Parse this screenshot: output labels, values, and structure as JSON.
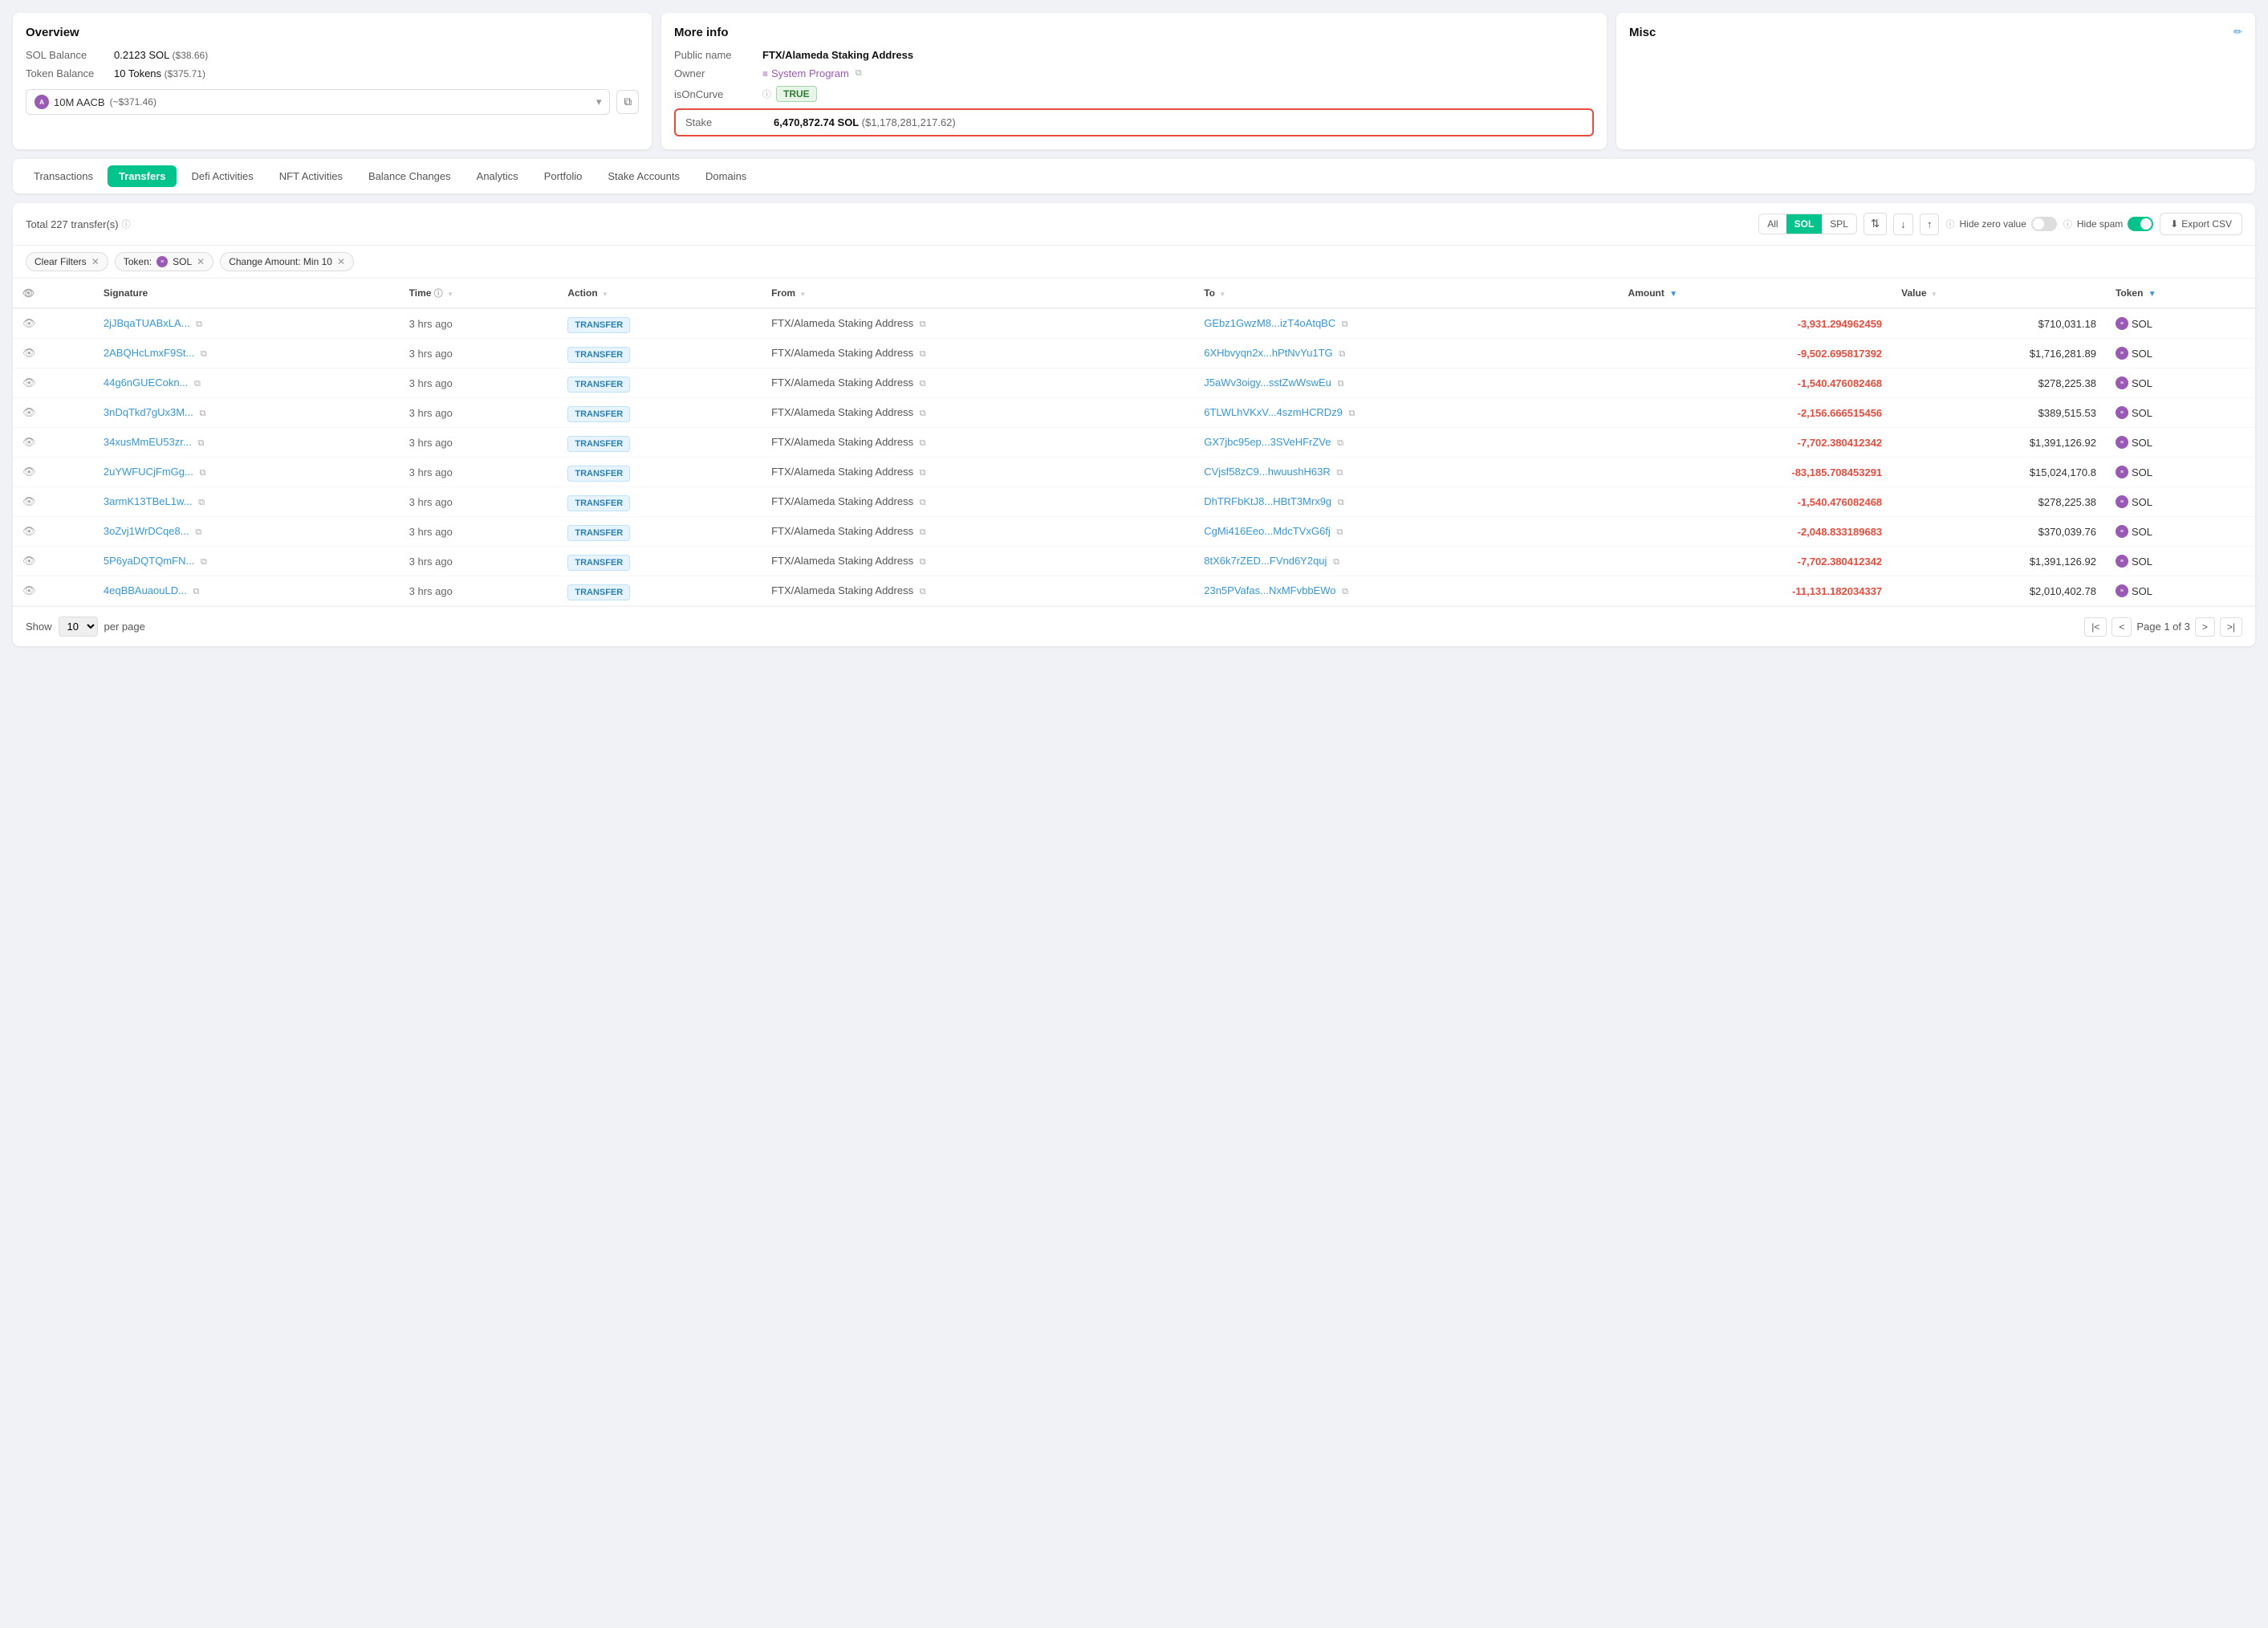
{
  "overview": {
    "title": "Overview",
    "sol_balance_label": "SOL Balance",
    "sol_balance_value": "0.2123 SOL",
    "sol_balance_usd": "($38.66)",
    "token_balance_label": "Token Balance",
    "token_balance_value": "10 Tokens",
    "token_balance_usd": "($375.71)",
    "token_name": "10M AACB",
    "token_usd": "(~$371.46)"
  },
  "moreinfo": {
    "title": "More info",
    "public_name_label": "Public name",
    "public_name_value": "FTX/Alameda Staking Address",
    "owner_label": "Owner",
    "owner_value": "System Program",
    "is_on_curve_label": "isOnCurve",
    "is_on_curve_value": "TRUE",
    "stake_label": "Stake",
    "stake_value": "6,470,872.74 SOL",
    "stake_usd": "($1,178,281,217.62)"
  },
  "misc": {
    "title": "Misc"
  },
  "tabs": [
    {
      "label": "Transactions",
      "active": false
    },
    {
      "label": "Transfers",
      "active": true
    },
    {
      "label": "Defi Activities",
      "active": false
    },
    {
      "label": "NFT Activities",
      "active": false
    },
    {
      "label": "Balance Changes",
      "active": false
    },
    {
      "label": "Analytics",
      "active": false
    },
    {
      "label": "Portfolio",
      "active": false
    },
    {
      "label": "Stake Accounts",
      "active": false
    },
    {
      "label": "Domains",
      "active": false
    }
  ],
  "table": {
    "total_transfers": "Total 227 transfer(s)",
    "filter_all": "All",
    "filter_sol": "SOL",
    "filter_spl": "SPL",
    "hide_zero_label": "Hide zero value",
    "hide_spam_label": "Hide spam",
    "export_label": "Export CSV",
    "active_filter": "SOL",
    "filters": [
      {
        "label": "Clear Filters"
      },
      {
        "label": "Token:",
        "value": "SOL",
        "has_icon": true
      },
      {
        "label": "Change Amount: Min 10"
      }
    ],
    "columns": [
      {
        "label": "",
        "key": "eye"
      },
      {
        "label": "Signature",
        "key": "sig"
      },
      {
        "label": "Time",
        "key": "time"
      },
      {
        "label": "Action",
        "key": "action"
      },
      {
        "label": "From",
        "key": "from"
      },
      {
        "label": "To",
        "key": "to"
      },
      {
        "label": "Amount",
        "key": "amount",
        "filtered": true
      },
      {
        "label": "Value",
        "key": "value",
        "filtered": true
      },
      {
        "label": "Token",
        "key": "token",
        "filtered": true
      }
    ],
    "rows": [
      {
        "sig": "2jJBqaTUABxLA...",
        "time": "3 hrs ago",
        "action": "TRANSFER",
        "from": "FTX/Alameda Staking Address",
        "to": "GEbz1GwzM8...izT4oAtqBC",
        "amount": "-3,931.294962459",
        "value": "$710,031.18",
        "token": "SOL"
      },
      {
        "sig": "2ABQHcLmxF9St...",
        "time": "3 hrs ago",
        "action": "TRANSFER",
        "from": "FTX/Alameda Staking Address",
        "to": "6XHbvyqn2x...hPtNvYu1TG",
        "amount": "-9,502.695817392",
        "value": "$1,716,281.89",
        "token": "SOL"
      },
      {
        "sig": "44g6nGUECokn...",
        "time": "3 hrs ago",
        "action": "TRANSFER",
        "from": "FTX/Alameda Staking Address",
        "to": "J5aWv3oigy...sstZwWswEu",
        "amount": "-1,540.476082468",
        "value": "$278,225.38",
        "token": "SOL"
      },
      {
        "sig": "3nDqTkd7gUx3M...",
        "time": "3 hrs ago",
        "action": "TRANSFER",
        "from": "FTX/Alameda Staking Address",
        "to": "6TLWLhVKxV...4szmHCRDz9",
        "amount": "-2,156.666515456",
        "value": "$389,515.53",
        "token": "SOL"
      },
      {
        "sig": "34xusMmEU53zr...",
        "time": "3 hrs ago",
        "action": "TRANSFER",
        "from": "FTX/Alameda Staking Address",
        "to": "GX7jbc95ep...3SVeHFrZVe",
        "amount": "-7,702.380412342",
        "value": "$1,391,126.92",
        "token": "SOL"
      },
      {
        "sig": "2uYWFUCjFmGg...",
        "time": "3 hrs ago",
        "action": "TRANSFER",
        "from": "FTX/Alameda Staking Address",
        "to": "CVjsf58zC9...hwuushH63R",
        "amount": "-83,185.708453291",
        "value": "$15,024,170.8",
        "token": "SOL"
      },
      {
        "sig": "3armK13TBeL1w...",
        "time": "3 hrs ago",
        "action": "TRANSFER",
        "from": "FTX/Alameda Staking Address",
        "to": "DhTRFbKtJ8...HBtT3Mrx9g",
        "amount": "-1,540.476082468",
        "value": "$278,225.38",
        "token": "SOL"
      },
      {
        "sig": "3oZvj1WrDCqe8...",
        "time": "3 hrs ago",
        "action": "TRANSFER",
        "from": "FTX/Alameda Staking Address",
        "to": "CgMi416Eeo...MdcTVxG6fj",
        "amount": "-2,048.833189683",
        "value": "$370,039.76",
        "token": "SOL"
      },
      {
        "sig": "5P6yaDQTQmFN...",
        "time": "3 hrs ago",
        "action": "TRANSFER",
        "from": "FTX/Alameda Staking Address",
        "to": "8tX6k7rZED...FVnd6Y2quj",
        "amount": "-7,702.380412342",
        "value": "$1,391,126.92",
        "token": "SOL"
      },
      {
        "sig": "4eqBBAuaouLD...",
        "time": "3 hrs ago",
        "action": "TRANSFER",
        "from": "FTX/Alameda Staking Address",
        "to": "23n5PVafas...NxMFvbbEWo",
        "amount": "-11,131.182034337",
        "value": "$2,010,402.78",
        "token": "SOL"
      }
    ],
    "pagination": {
      "show_label": "Show",
      "per_page_value": "10",
      "per_page_label": "per page",
      "page_info": "Page 1 of 3"
    }
  }
}
